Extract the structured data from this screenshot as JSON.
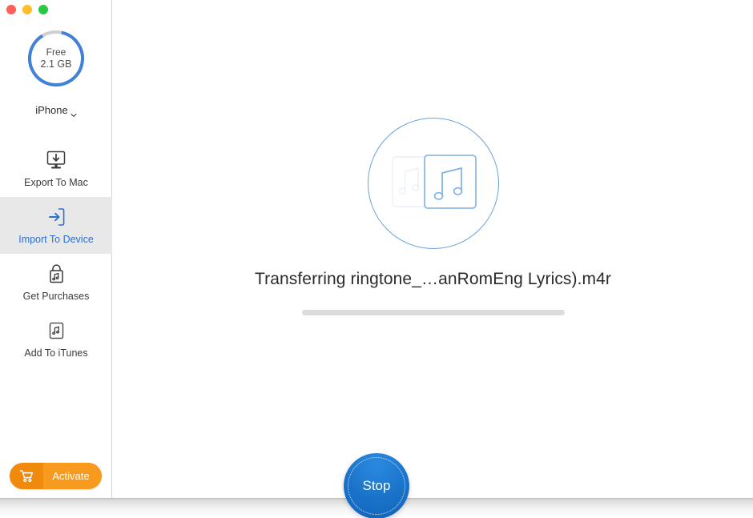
{
  "window": {
    "traffic_lights": [
      {
        "name": "close",
        "color": "#FF5F57"
      },
      {
        "name": "minimize",
        "color": "#FFBD2E"
      },
      {
        "name": "maximize",
        "color": "#28C940"
      }
    ]
  },
  "sidebar": {
    "storage": {
      "label": "Free",
      "value": "2.1 GB",
      "free_percent": 88,
      "ring_color": "#3f82d6",
      "track_color": "#cfcfcf"
    },
    "device": {
      "name": "iPhone",
      "chevron": "chevron-down-icon"
    },
    "items": [
      {
        "label": "Export To Mac",
        "icon": "monitor-download-icon",
        "selected": false
      },
      {
        "label": "Import To Device",
        "icon": "import-arrow-icon",
        "selected": true
      },
      {
        "label": "Get Purchases",
        "icon": "shopping-bag-music-icon",
        "selected": false
      },
      {
        "label": "Add To iTunes",
        "icon": "music-square-icon",
        "selected": false
      }
    ],
    "selected_color": "#2f6fd0",
    "activate": {
      "label": "Activate",
      "icon": "shopping-cart-icon",
      "color": "#f79a1e"
    }
  },
  "main": {
    "artwork": {
      "icon": "music-cards-icon",
      "circle_color": "#6a9fd8"
    },
    "status_text": "Transferring ringtone_…anRomEng Lyrics).m4r",
    "progress": {
      "percent": 0,
      "track_color": "#dcdcdc",
      "fill_color": "#2f81d8"
    },
    "stop_button": {
      "label": "Stop",
      "color": "#1a72c8"
    }
  }
}
